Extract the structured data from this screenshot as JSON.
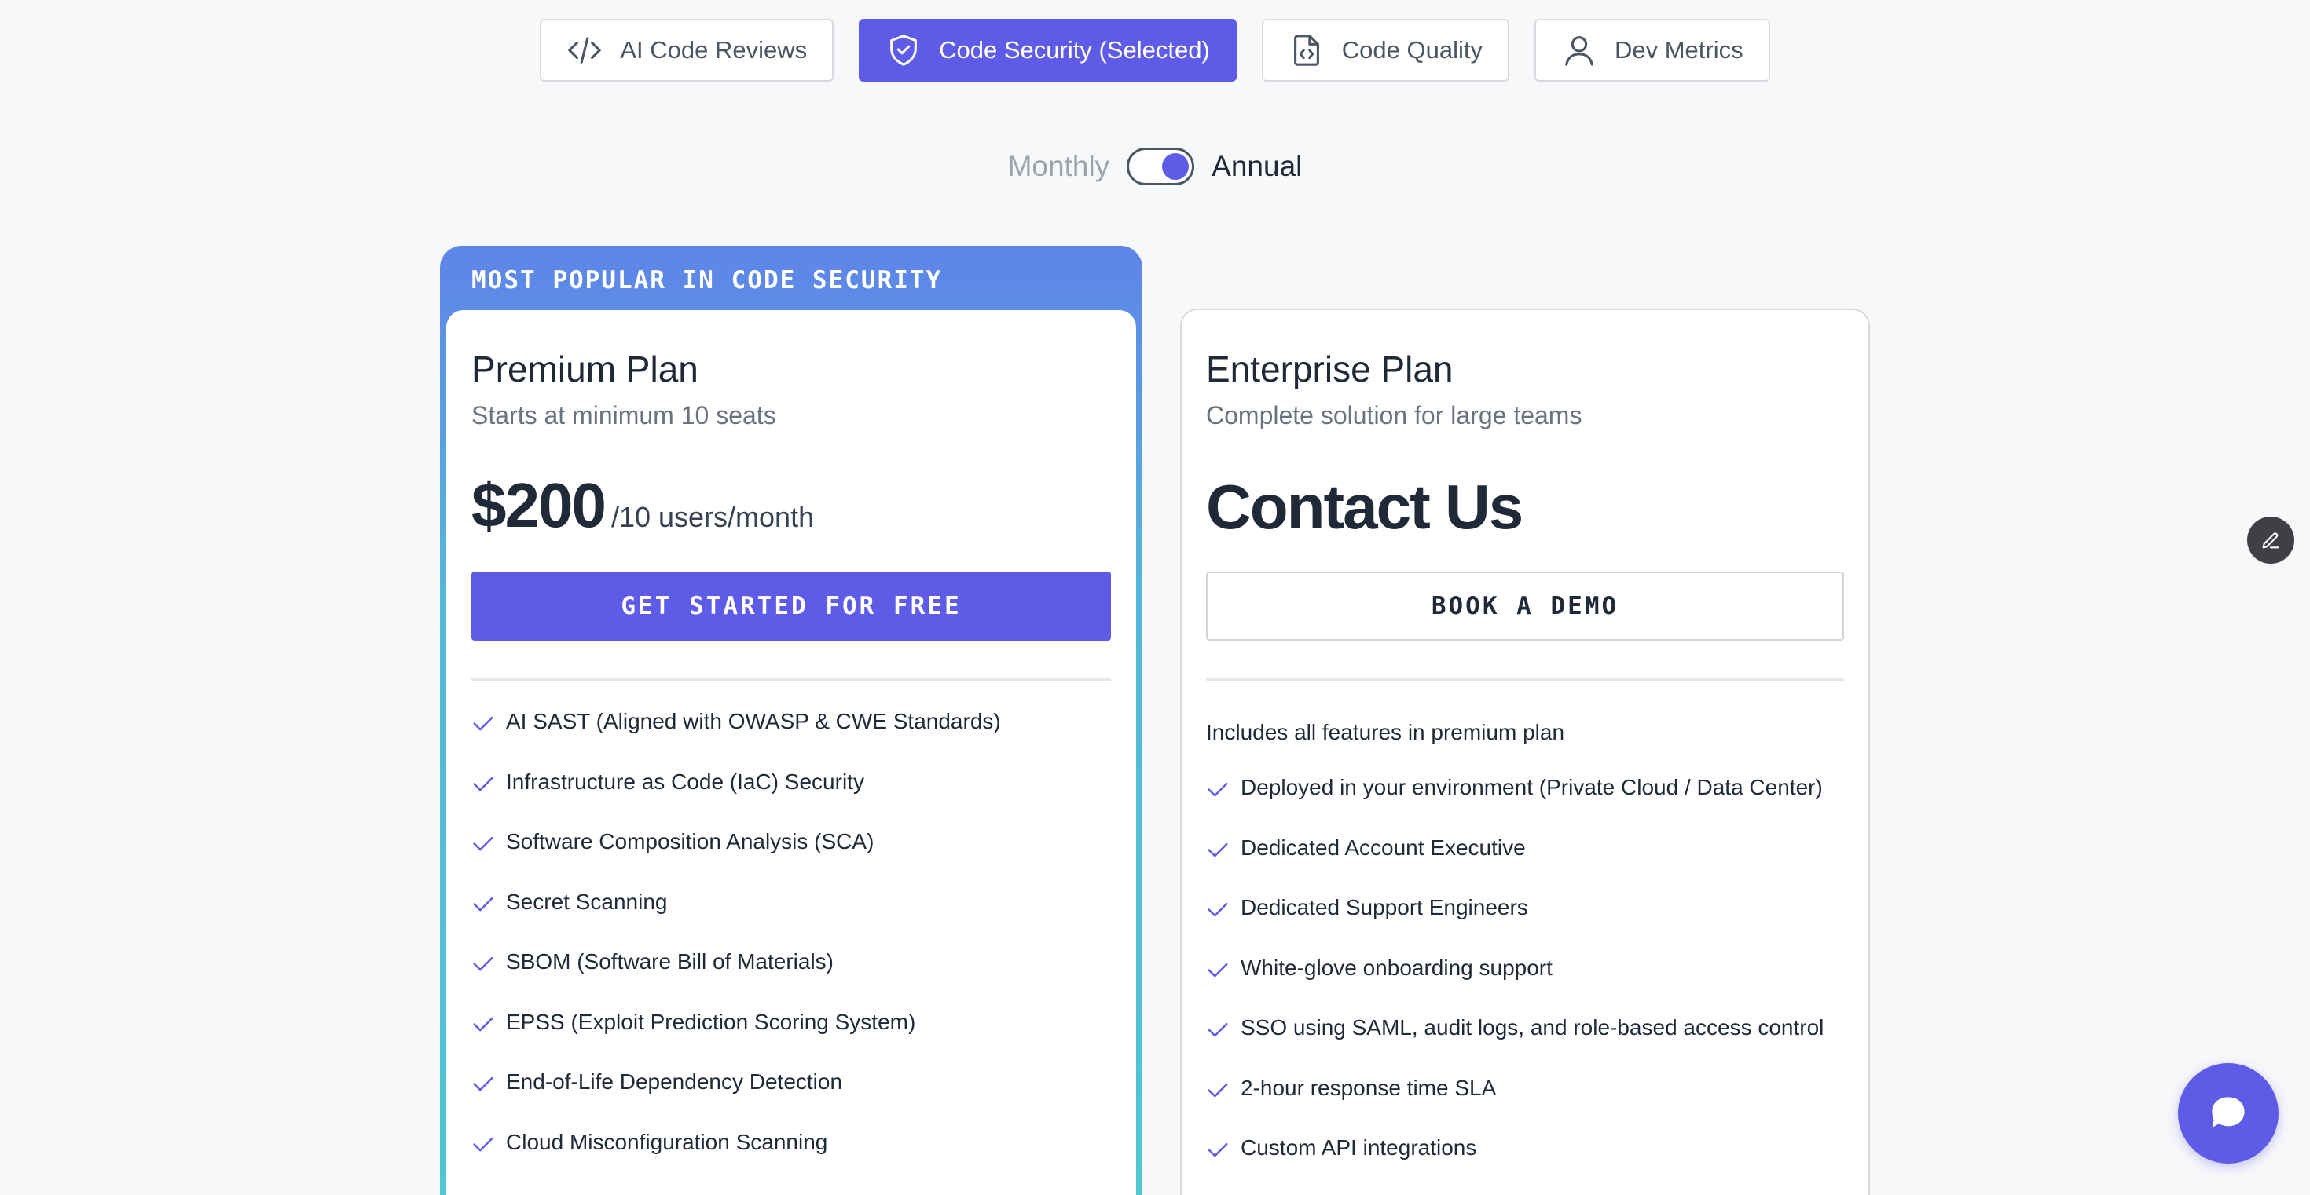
{
  "tabs": [
    {
      "label": "AI Code Reviews",
      "icon": "code-icon",
      "selected": false
    },
    {
      "label": "Code Security (Selected)",
      "icon": "shield-check-icon",
      "selected": true
    },
    {
      "label": "Code Quality",
      "icon": "code-file-icon",
      "selected": false
    },
    {
      "label": "Dev Metrics",
      "icon": "user-icon",
      "selected": false
    }
  ],
  "billing": {
    "monthly_label": "Monthly",
    "annual_label": "Annual",
    "selected": "Annual"
  },
  "premium": {
    "badge": "MOST POPULAR IN CODE SECURITY",
    "name": "Premium Plan",
    "subtitle": "Starts at minimum 10 seats",
    "price": "$200",
    "price_unit": "/10 users/month",
    "cta": "GET STARTED FOR FREE",
    "features": [
      "AI SAST (Aligned with OWASP & CWE Standards)",
      "Infrastructure as Code (IaC) Security",
      "Software Composition Analysis (SCA)",
      "Secret Scanning",
      "SBOM (Software Bill of Materials)",
      "EPSS (Exploit Prediction Scoring System)",
      "End-of-Life Dependency Detection",
      "Cloud Misconfiguration Scanning"
    ]
  },
  "enterprise": {
    "name": "Enterprise Plan",
    "subtitle": "Complete solution for large teams",
    "price_text": "Contact Us",
    "cta": "BOOK A DEMO",
    "includes": "Includes all features in premium plan",
    "features": [
      "Deployed in your environment (Private Cloud / Data Center)",
      "Dedicated Account Executive",
      "Dedicated Support Engineers",
      "White-glove onboarding support",
      "SSO using SAML, audit logs, and role-based access control",
      "2-hour response time SLA",
      "Custom API integrations"
    ]
  },
  "colors": {
    "accent": "#5e5ce6",
    "background": "#f7f8f9",
    "gradient_top": "#5e84e8",
    "gradient_bottom": "#4fc7cf"
  }
}
